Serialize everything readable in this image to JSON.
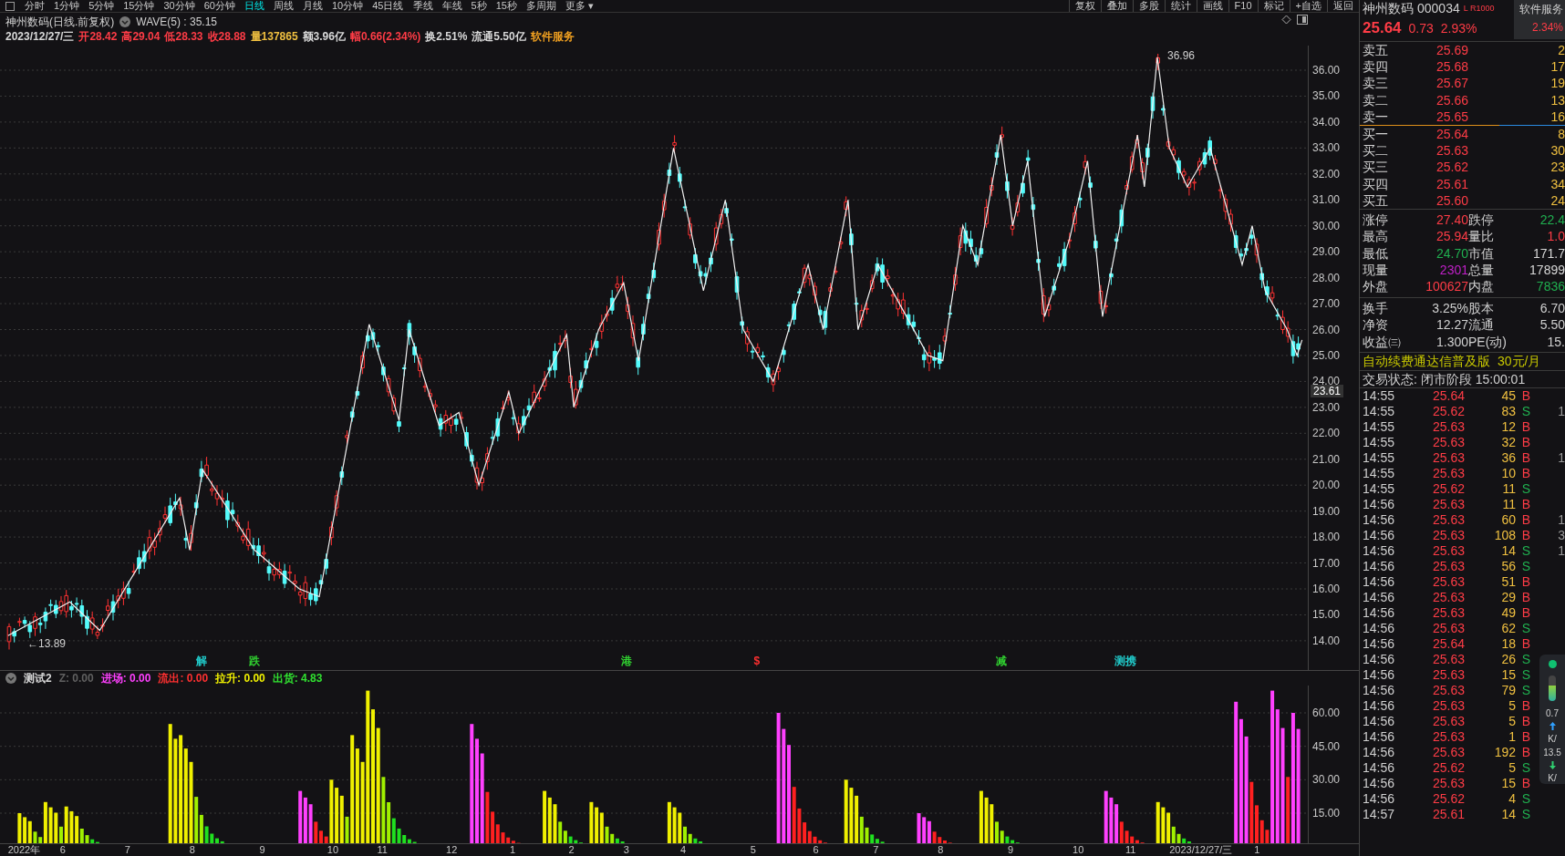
{
  "toolbar": {
    "periods": [
      {
        "label": "分时",
        "selected": false
      },
      {
        "label": "1分钟",
        "selected": false
      },
      {
        "label": "5分钟",
        "selected": false
      },
      {
        "label": "15分钟",
        "selected": false
      },
      {
        "label": "30分钟",
        "selected": false
      },
      {
        "label": "60分钟",
        "selected": false
      },
      {
        "label": "日线",
        "selected": true
      },
      {
        "label": "周线",
        "selected": false
      },
      {
        "label": "月线",
        "selected": false
      },
      {
        "label": "10分钟",
        "selected": false
      },
      {
        "label": "45日线",
        "selected": false
      },
      {
        "label": "季线",
        "selected": false
      },
      {
        "label": "年线",
        "selected": false
      },
      {
        "label": "5秒",
        "selected": false
      },
      {
        "label": "15秒",
        "selected": false
      },
      {
        "label": "多周期",
        "selected": false
      },
      {
        "label": "更多 ▾",
        "selected": false
      }
    ],
    "actions": [
      "复权",
      "叠加",
      "多股",
      "统计",
      "画线",
      "F10",
      "标记",
      "+自选",
      "返回"
    ]
  },
  "chart": {
    "title": "神州数码(日线.前复权)",
    "indicator": "WAVE(5) : 35.15",
    "info": [
      {
        "text": "2023/12/27/三",
        "color": "#d8d8d8"
      },
      {
        "text": "开28.42",
        "color": "#ff3c46"
      },
      {
        "text": "高29.04",
        "color": "#ff3c46"
      },
      {
        "text": "低28.33",
        "color": "#ff3c46"
      },
      {
        "text": "收28.88",
        "color": "#ff3c46"
      },
      {
        "text": "量137865",
        "color": "#f0c040"
      },
      {
        "text": "额3.96亿",
        "color": "#d8d8d8"
      },
      {
        "text": "幅0.66(2.34%)",
        "color": "#ff3c46"
      },
      {
        "text": "换2.51%",
        "color": "#d8d8d8"
      },
      {
        "text": "流通5.50亿",
        "color": "#d8d8d8"
      },
      {
        "text": "软件服务",
        "color": "#f0a020"
      }
    ],
    "price_ticks": [
      "36.00",
      "35.00",
      "34.00",
      "33.00",
      "32.00",
      "31.00",
      "30.00",
      "29.00",
      "28.00",
      "27.00",
      "26.00",
      "25.00",
      "24.00",
      "23.00",
      "22.00",
      "21.00",
      "20.00",
      "19.00",
      "18.00",
      "17.00",
      "16.00",
      "15.00",
      "14.00"
    ],
    "current_price_tag": "23.61",
    "high_label": "36.96",
    "low_label": "←13.89",
    "signals": [
      {
        "text": "解",
        "color": "#20c8c8"
      },
      {
        "text": "跌",
        "color": "#30d030"
      },
      {
        "text": "港",
        "color": "#30d030"
      },
      {
        "text": "$",
        "color": "#ff3030"
      },
      {
        "text": "减",
        "color": "#30d030"
      },
      {
        "text": "测携",
        "color": "#20c8c8"
      }
    ]
  },
  "indicator": {
    "legend": [
      {
        "text": "测试2",
        "color": "#d8d8d8"
      },
      {
        "text": "Z: 0.00",
        "color": "#606060"
      },
      {
        "text": "进场: 0.00",
        "color": "#ff40ff"
      },
      {
        "text": "流出: 0.00",
        "color": "#ff3030"
      },
      {
        "text": "拉升: 0.00",
        "color": "#f0f000"
      },
      {
        "text": "出货: 4.83",
        "color": "#30e030"
      }
    ],
    "ticks": [
      "60.00",
      "45.00",
      "30.00",
      "15.00"
    ]
  },
  "x_axis": [
    "2022年",
    "6",
    "7",
    "8",
    "9",
    "10",
    "11",
    "12",
    "1",
    "2",
    "3",
    "4",
    "5",
    "6",
    "7",
    "8",
    "9",
    "10",
    "11",
    "2023/12/27/三",
    "1"
  ],
  "quote": {
    "name": "神州数码",
    "code": "000034",
    "tag": "L R1000",
    "sector": "软件服务",
    "sector_change": "2.34%",
    "price": "25.64",
    "change": "0.73",
    "change_pct": "2.93%",
    "asks": [
      {
        "label": "卖五",
        "price": "25.69",
        "volume": "2"
      },
      {
        "label": "卖四",
        "price": "25.68",
        "volume": "17"
      },
      {
        "label": "卖三",
        "price": "25.67",
        "volume": "19"
      },
      {
        "label": "卖二",
        "price": "25.66",
        "volume": "13"
      },
      {
        "label": "卖一",
        "price": "25.65",
        "volume": "16"
      }
    ],
    "bids": [
      {
        "label": "买一",
        "price": "25.64",
        "volume": "8"
      },
      {
        "label": "买二",
        "price": "25.63",
        "volume": "30"
      },
      {
        "label": "买三",
        "price": "25.62",
        "volume": "23"
      },
      {
        "label": "买四",
        "price": "25.61",
        "volume": "34"
      },
      {
        "label": "买五",
        "price": "25.60",
        "volume": "24"
      }
    ],
    "stats": [
      {
        "label": "涨停",
        "value": "27.40",
        "color": "#ff3c46"
      },
      {
        "label": "跌停",
        "value": "22.4",
        "color": "#20b050"
      },
      {
        "label": "最高",
        "value": "25.94",
        "color": "#ff3c46"
      },
      {
        "label": "量比",
        "value": "1.0",
        "color": "#ff3c46"
      },
      {
        "label": "最低",
        "value": "24.70",
        "color": "#20b050"
      },
      {
        "label": "市值",
        "value": "171.7",
        "color": "#d8d8d8"
      },
      {
        "label": "现量",
        "value": "2301",
        "color": "#c020c8"
      },
      {
        "label": "总量",
        "value": "17899",
        "color": "#d8d8d8"
      },
      {
        "label": "外盘",
        "value": "100627",
        "color": "#ff3c46"
      },
      {
        "label": "内盘",
        "value": "7836",
        "color": "#20b050"
      }
    ],
    "fundamentals": [
      {
        "label": "换手",
        "value": "3.25%",
        "label2": "股本",
        "value2": "6.70"
      },
      {
        "label": "净资",
        "value": "12.27",
        "label2": "流通",
        "value2": "5.50"
      },
      {
        "label": "收益㈢",
        "value": "1.300",
        "label2": "PE(动)",
        "value2": "15."
      }
    ],
    "promo": {
      "text": "自动续费通达信普及版",
      "price": "30元/月"
    },
    "status": "交易状态: 闭市阶段 15:00:01",
    "trades": [
      {
        "time": "14:55",
        "price": "25.64",
        "volume": "45",
        "side": "B",
        "kind": "buy"
      },
      {
        "time": "14:55",
        "price": "25.62",
        "volume": "83",
        "side": "S",
        "kind": "sell",
        "extra": "1"
      },
      {
        "time": "14:55",
        "price": "25.63",
        "volume": "12",
        "side": "B",
        "kind": "buy"
      },
      {
        "time": "14:55",
        "price": "25.63",
        "volume": "32",
        "side": "B",
        "kind": "buy"
      },
      {
        "time": "14:55",
        "price": "25.63",
        "volume": "36",
        "side": "B",
        "kind": "buy",
        "extra": "1"
      },
      {
        "time": "14:55",
        "price": "25.63",
        "volume": "10",
        "side": "B",
        "kind": "buy"
      },
      {
        "time": "14:55",
        "price": "25.62",
        "volume": "11",
        "side": "S",
        "kind": "sell"
      },
      {
        "time": "14:56",
        "price": "25.63",
        "volume": "11",
        "side": "B",
        "kind": "buy"
      },
      {
        "time": "14:56",
        "price": "25.63",
        "volume": "60",
        "side": "B",
        "kind": "buy",
        "extra": "1"
      },
      {
        "time": "14:56",
        "price": "25.63",
        "volume": "108",
        "side": "B",
        "kind": "buy",
        "extra": "3"
      },
      {
        "time": "14:56",
        "price": "25.63",
        "volume": "14",
        "side": "S",
        "kind": "sell",
        "extra": "1"
      },
      {
        "time": "14:56",
        "price": "25.63",
        "volume": "56",
        "side": "S",
        "kind": "sell"
      },
      {
        "time": "14:56",
        "price": "25.63",
        "volume": "51",
        "side": "B",
        "kind": "buy"
      },
      {
        "time": "14:56",
        "price": "25.63",
        "volume": "29",
        "side": "B",
        "kind": "buy"
      },
      {
        "time": "14:56",
        "price": "25.63",
        "volume": "49",
        "side": "B",
        "kind": "buy"
      },
      {
        "time": "14:56",
        "price": "25.63",
        "volume": "62",
        "side": "S",
        "kind": "sell"
      },
      {
        "time": "14:56",
        "price": "25.64",
        "volume": "18",
        "side": "B",
        "kind": "buy"
      },
      {
        "time": "14:56",
        "price": "25.63",
        "volume": "26",
        "side": "S",
        "kind": "sell"
      },
      {
        "time": "14:56",
        "price": "25.63",
        "volume": "15",
        "side": "S",
        "kind": "sell"
      },
      {
        "time": "14:56",
        "price": "25.63",
        "volume": "79",
        "side": "S",
        "kind": "sell"
      },
      {
        "time": "14:56",
        "price": "25.63",
        "volume": "5",
        "side": "B",
        "kind": "buy"
      },
      {
        "time": "14:56",
        "price": "25.63",
        "volume": "5",
        "side": "B",
        "kind": "buy"
      },
      {
        "time": "14:56",
        "price": "25.63",
        "volume": "1",
        "side": "B",
        "kind": "buy"
      },
      {
        "time": "14:56",
        "price": "25.63",
        "volume": "192",
        "side": "B",
        "kind": "buy"
      },
      {
        "time": "14:56",
        "price": "25.62",
        "volume": "5",
        "side": "S",
        "kind": "sell"
      },
      {
        "time": "14:56",
        "price": "25.63",
        "volume": "15",
        "side": "B",
        "kind": "buy"
      },
      {
        "time": "14:56",
        "price": "25.62",
        "volume": "4",
        "side": "S",
        "kind": "sell"
      },
      {
        "time": "14:57",
        "price": "25.61",
        "volume": "14",
        "side": "S",
        "kind": "sell"
      }
    ],
    "speed_widget": {
      "up": "0.7",
      "up_unit": "K/",
      "down": "13.5",
      "down_unit": "K/"
    }
  }
}
